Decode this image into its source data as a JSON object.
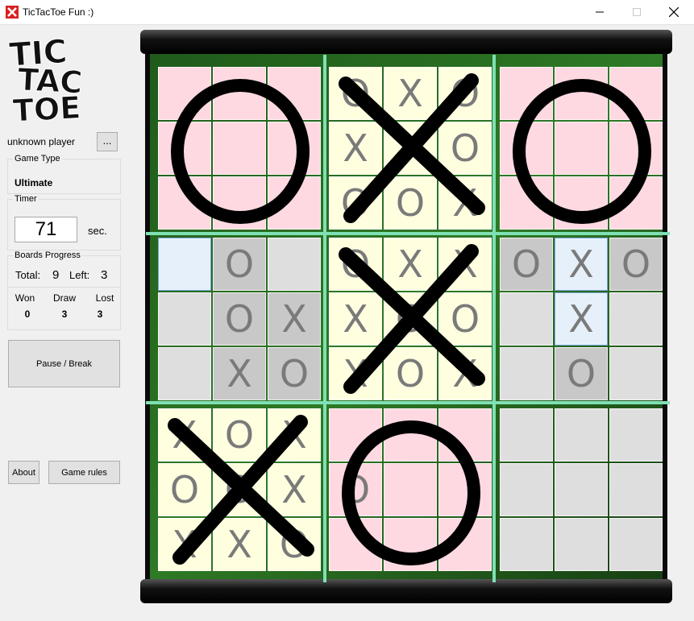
{
  "window": {
    "title": "TicTacToe Fun :)"
  },
  "sidebar": {
    "logo_text": [
      "TIC",
      "TAC",
      "TOE"
    ],
    "player_name": "unknown player",
    "player_button": "...",
    "game_type_label": "Game Type",
    "game_type_value": "Ultimate",
    "timer_label": "Timer",
    "timer_value": "71",
    "timer_unit": "sec.",
    "progress_label": "Boards Progress",
    "total_label": "Total:",
    "total_value": "9",
    "left_label": "Left:",
    "left_value": "3",
    "won_label": "Won",
    "won_value": "0",
    "draw_label": "Draw",
    "draw_value": "3",
    "lost_label": "Lost",
    "lost_value": "3",
    "pause_button": "Pause / Break",
    "about_button": "About",
    "rules_button": "Game rules"
  },
  "board": {
    "colors": {
      "o_won": "#ffd9e1",
      "x_won": "#ffffe0",
      "neutral": "#dedede",
      "played": "#c8c8c8",
      "highlight": "#e6f0fa",
      "grid_line": "#7fe0b4",
      "mark": "#7a7a7a"
    },
    "subboards": [
      {
        "state": "O",
        "cells": [
          "",
          "",
          "",
          "",
          "",
          "",
          "",
          "",
          ""
        ],
        "bg": [
          "o",
          "o",
          "o",
          "o",
          "o",
          "o",
          "o",
          "o",
          "o"
        ]
      },
      {
        "state": "X",
        "cells": [
          "O",
          "X",
          "O",
          "X",
          "X",
          "O",
          "O",
          "O",
          "X"
        ],
        "bg": [
          "x",
          "x",
          "x",
          "x",
          "x",
          "x",
          "x",
          "x",
          "x"
        ]
      },
      {
        "state": "O",
        "cells": [
          "",
          "",
          "",
          "",
          "",
          "",
          "",
          "",
          ""
        ],
        "bg": [
          "o",
          "o",
          "o",
          "o",
          "o",
          "o",
          "o",
          "o",
          "o"
        ]
      },
      {
        "state": "",
        "cells": [
          "",
          "O",
          "",
          "",
          "O",
          "X",
          "",
          "X",
          "O"
        ],
        "bg": [
          "h",
          "p",
          "n",
          "n",
          "p",
          "p",
          "n",
          "p",
          "p"
        ]
      },
      {
        "state": "X",
        "cells": [
          "O",
          "X",
          "X",
          "X",
          "O",
          "O",
          "X",
          "O",
          "X"
        ],
        "bg": [
          "x",
          "x",
          "x",
          "x",
          "x",
          "x",
          "x",
          "x",
          "x"
        ]
      },
      {
        "state": "",
        "cells": [
          "O",
          "X",
          "O",
          "",
          "X",
          "",
          "",
          "O",
          ""
        ],
        "bg": [
          "p",
          "h",
          "p",
          "n",
          "h",
          "n",
          "n",
          "p",
          "n"
        ]
      },
      {
        "state": "X",
        "cells": [
          "X",
          "O",
          "X",
          "O",
          "O",
          "X",
          "X",
          "X",
          "O"
        ],
        "bg": [
          "x",
          "x",
          "x",
          "x",
          "x",
          "x",
          "x",
          "x",
          "x"
        ]
      },
      {
        "state": "O",
        "cells": [
          "",
          "",
          "",
          "O",
          "",
          "",
          "",
          "",
          ""
        ],
        "bg": [
          "o",
          "o",
          "o",
          "o",
          "o",
          "o",
          "o",
          "o",
          "o"
        ]
      },
      {
        "state": "",
        "cells": [
          "",
          "",
          "",
          "",
          "",
          "",
          "",
          "",
          ""
        ],
        "bg": [
          "n",
          "n",
          "n",
          "n",
          "n",
          "n",
          "n",
          "n",
          "n"
        ]
      }
    ]
  }
}
